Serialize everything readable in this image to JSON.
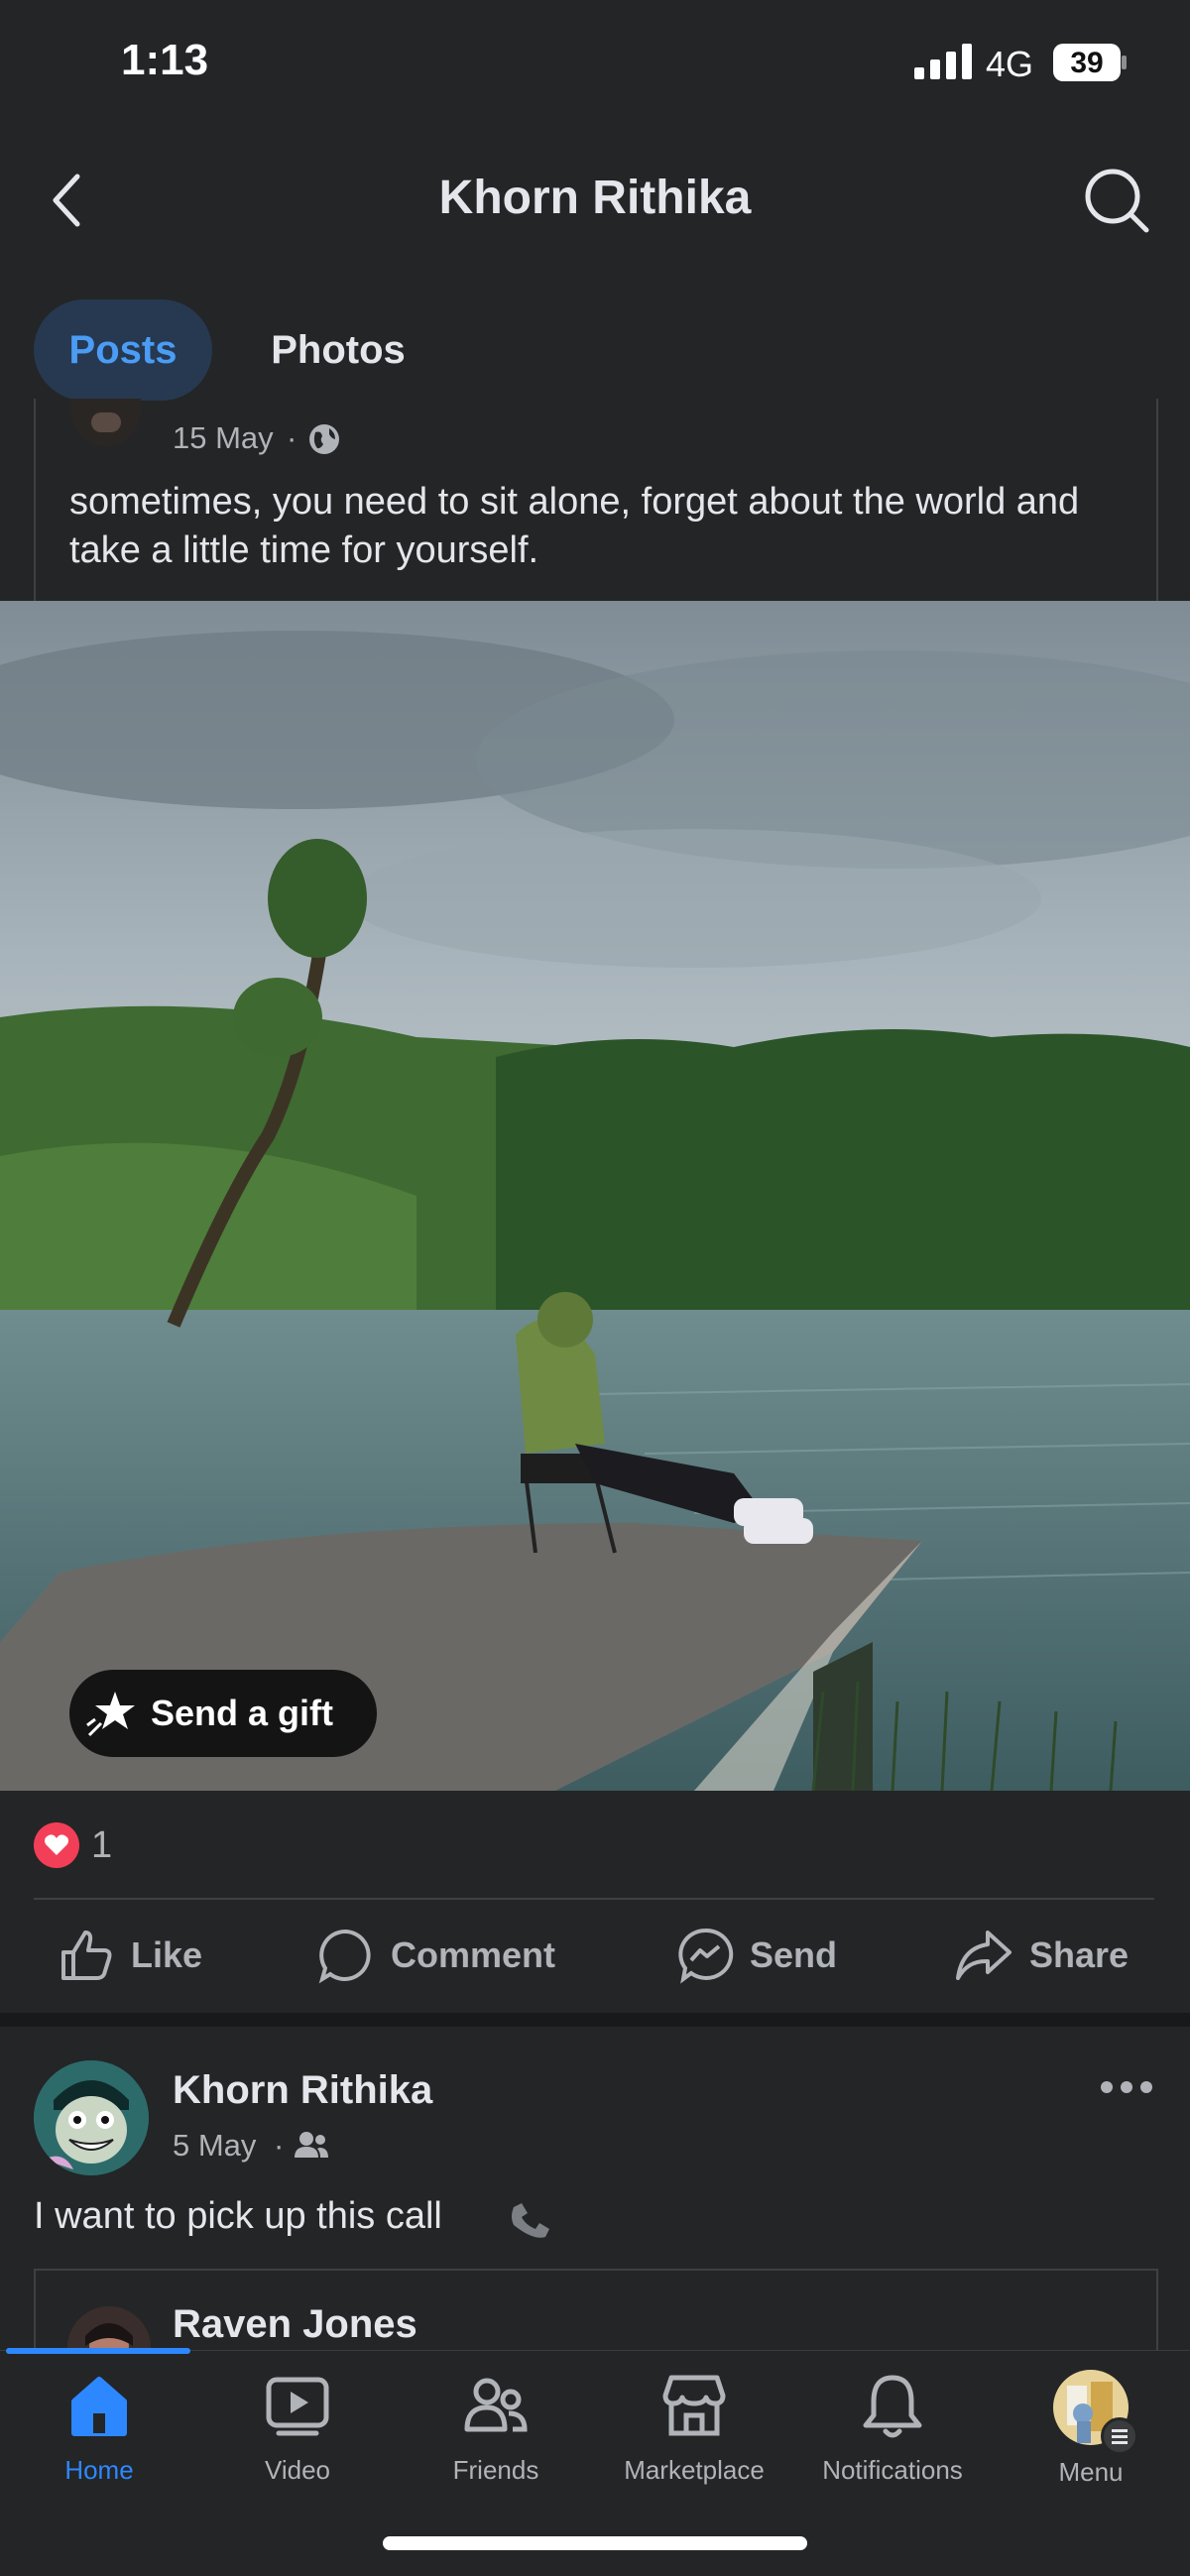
{
  "status_bar": {
    "time": "1:13",
    "network": "4G",
    "battery": "39"
  },
  "header": {
    "title": "Khorn Rithika"
  },
  "tabs": [
    {
      "label": "Posts",
      "active": true
    },
    {
      "label": "Photos",
      "active": false
    }
  ],
  "shared_post": {
    "date": "15 May",
    "separator": "·",
    "audience_icon": "globe-icon",
    "text": "sometimes, you need to sit alone, forget about the world and take a little time for yourself.",
    "gift_label": "Send a gift"
  },
  "reactions": {
    "icon": "heart-reaction",
    "count": "1"
  },
  "actions": [
    {
      "label": "Like",
      "icon": "like-icon"
    },
    {
      "label": "Comment",
      "icon": "comment-icon"
    },
    {
      "label": "Send",
      "icon": "messenger-icon"
    },
    {
      "label": "Share",
      "icon": "share-icon"
    }
  ],
  "second_post": {
    "author": "Khorn Rithika",
    "date": "5 May",
    "separator": "·",
    "audience_icon": "friends-icon",
    "text": "I want to pick up this call",
    "emoji_icon": "phone-icon",
    "shared_author": "Raven Jones"
  },
  "bottom_nav": [
    {
      "label": "Home",
      "icon": "home-icon",
      "active": true
    },
    {
      "label": "Video",
      "icon": "video-icon",
      "active": false
    },
    {
      "label": "Friends",
      "icon": "friends-icon",
      "active": false
    },
    {
      "label": "Marketplace",
      "icon": "marketplace-icon",
      "active": false
    },
    {
      "label": "Notifications",
      "icon": "bell-icon",
      "active": false
    },
    {
      "label": "Menu",
      "icon": "menu-avatar",
      "active": false
    }
  ],
  "colors": {
    "background": "#242526",
    "accent": "#2d88ff",
    "tab_active_bg": "#263951",
    "heart": "#f33e58"
  }
}
